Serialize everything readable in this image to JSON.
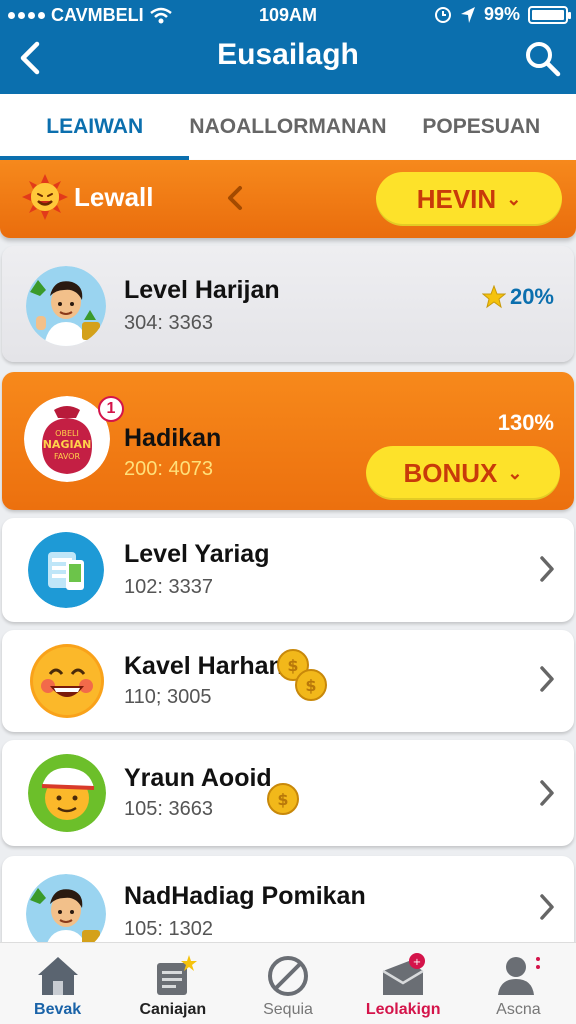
{
  "status": {
    "carrier": "CAVMBELI",
    "time": "109AM",
    "battery": "99%"
  },
  "header": {
    "title": "Eusailagh"
  },
  "tabs": [
    {
      "label": "LEAIWAN"
    },
    {
      "label": "NAOALLORMANAN"
    },
    {
      "label": "POPESUAN"
    }
  ],
  "level_banner": {
    "label": "Lewall",
    "button": "HEVIN",
    "button_icon": "chevron-down-icon"
  },
  "cards": [
    {
      "title": "Level Harijan",
      "sub": "304: 3363",
      "percent": "20%",
      "percent_icon": "star-icon",
      "colors": {
        "percent": "#0b6fae",
        "star": "#f5c20d"
      }
    },
    {
      "title": "Hadikan",
      "sub": "200: 4073",
      "percent": "130%",
      "badge": "1",
      "button": "BONUX",
      "avatar_text": [
        "OBELI",
        "NAGIAN",
        "FAVOR"
      ]
    },
    {
      "title": "Level Yariag",
      "sub": "102: 3337"
    },
    {
      "title": "Kavel Harhan",
      "sub": "110; 3005"
    },
    {
      "title": "Yraun Aooid",
      "sub": "105: 3663"
    },
    {
      "title": "NadHadiag Pomikan",
      "sub": "105: 1302"
    }
  ],
  "bottom_nav": [
    {
      "label": "Bevak",
      "icon": "home-icon",
      "color": "#1a63a8"
    },
    {
      "label": "Caniajan",
      "icon": "notebook-icon",
      "color": "#222222"
    },
    {
      "label": "Sequia",
      "icon": "block-icon",
      "color": "#777777"
    },
    {
      "label": "Leolakign",
      "icon": "mailbox-icon",
      "color": "#d4144a"
    },
    {
      "label": "Ascna",
      "icon": "user-icon",
      "color": "#777777"
    }
  ],
  "colors": {
    "brand": "#0b6fae",
    "accent": "#f6891c",
    "pill": "#fde22a",
    "pill_text": "#c83a0a"
  }
}
